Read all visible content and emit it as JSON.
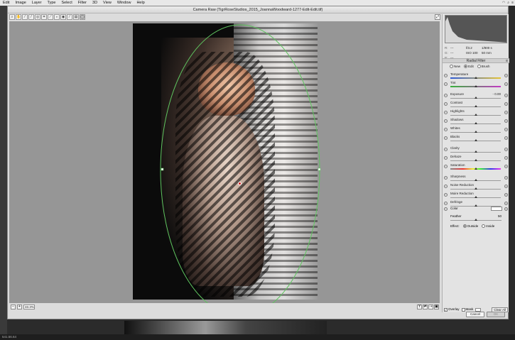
{
  "menubar": {
    "items": [
      "Edit",
      "Image",
      "Layer",
      "Type",
      "Select",
      "Filter",
      "3D",
      "View",
      "Window",
      "Help"
    ]
  },
  "dialog": {
    "title": "Camera Raw (TigrRoseStudios_2015_JoannaWoodward-1277-Edit-Edit.tif)"
  },
  "toolbar": {
    "tools": [
      {
        "name": "zoom-tool",
        "icon": "magnifier-icon",
        "glyph": "⌕"
      },
      {
        "name": "hand-tool",
        "icon": "hand-icon",
        "glyph": "✋"
      },
      {
        "name": "white-balance-tool",
        "icon": "eyedropper-icon",
        "glyph": "⁄"
      },
      {
        "name": "color-sampler-tool",
        "icon": "sampler-icon",
        "glyph": "⁄"
      },
      {
        "name": "targeted-adjustment-tool",
        "icon": "target-icon",
        "glyph": "◎"
      },
      {
        "name": "crop-tool",
        "icon": "crop-icon",
        "glyph": "⌗"
      },
      {
        "name": "straighten-tool",
        "icon": "straighten-icon",
        "glyph": "⟋"
      },
      {
        "name": "spot-removal-tool",
        "icon": "spot-icon",
        "glyph": "∘"
      },
      {
        "name": "red-eye-tool",
        "icon": "eye-icon",
        "glyph": "◉"
      },
      {
        "name": "adjustment-brush-tool",
        "icon": "brush-icon",
        "glyph": "⁄"
      },
      {
        "name": "graduated-filter-tool",
        "icon": "gradient-icon",
        "glyph": "▤"
      },
      {
        "name": "radial-filter-tool",
        "icon": "radial-icon",
        "glyph": "◯"
      }
    ],
    "active_index": 11
  },
  "zoom": {
    "value": "33.3%",
    "minus": "−",
    "plus": "+"
  },
  "histogram": {
    "exif": {
      "r": "R:",
      "g": "G:",
      "b": "B:",
      "r_val": "---",
      "g_val": "---",
      "b_val": "---",
      "aperture": "f/3.2",
      "shutter": "1/800 s",
      "iso": "ISO 100",
      "focal": "50 mm"
    }
  },
  "radial_filter": {
    "header": "Radial Filter",
    "modes": [
      {
        "label": "New",
        "selected": false
      },
      {
        "label": "Edit",
        "selected": true
      },
      {
        "label": "Brush",
        "selected": false
      }
    ],
    "sliders": [
      {
        "label": "Temperature",
        "value": "",
        "pos": 0.5,
        "kind": "temp"
      },
      {
        "label": "Tint",
        "value": "",
        "pos": 0.5,
        "kind": "tint"
      },
      {
        "label": "Exposure",
        "value": "- 0.00",
        "pos": 0.5,
        "kind": ""
      },
      {
        "label": "Contrast",
        "value": "",
        "pos": 0.5,
        "kind": ""
      },
      {
        "label": "Highlights",
        "value": "",
        "pos": 0.5,
        "kind": ""
      },
      {
        "label": "Shadows",
        "value": "",
        "pos": 0.5,
        "kind": ""
      },
      {
        "label": "Whites",
        "value": "",
        "pos": 0.5,
        "kind": ""
      },
      {
        "label": "Blacks",
        "value": "",
        "pos": 0.5,
        "kind": ""
      },
      {
        "label": "Clarity",
        "value": "",
        "pos": 0.5,
        "kind": ""
      },
      {
        "label": "Dehaze",
        "value": "",
        "pos": 0.5,
        "kind": ""
      },
      {
        "label": "Saturation",
        "value": "",
        "pos": 0.5,
        "kind": "sat"
      },
      {
        "label": "Sharpness",
        "value": "",
        "pos": 0.5,
        "kind": ""
      },
      {
        "label": "Noise Reduction",
        "value": "",
        "pos": 0.5,
        "kind": ""
      },
      {
        "label": "Moire Reduction",
        "value": "",
        "pos": 0.5,
        "kind": ""
      },
      {
        "label": "Defringe",
        "value": "",
        "pos": 0.5,
        "kind": ""
      }
    ],
    "color_label": "Color",
    "feather_label": "Feather",
    "feather_value": "50",
    "feather_pos": 0.5,
    "effect_label": "Effect:",
    "effect_outside": "Outside",
    "effect_inside": "Inside",
    "overlay_label": "Overlay",
    "mask_label": "Mask",
    "clear_all": "Clear All"
  },
  "footer": {
    "cancel": "Cancel",
    "ok": "OK"
  },
  "status": {
    "text": "541.56.64"
  }
}
